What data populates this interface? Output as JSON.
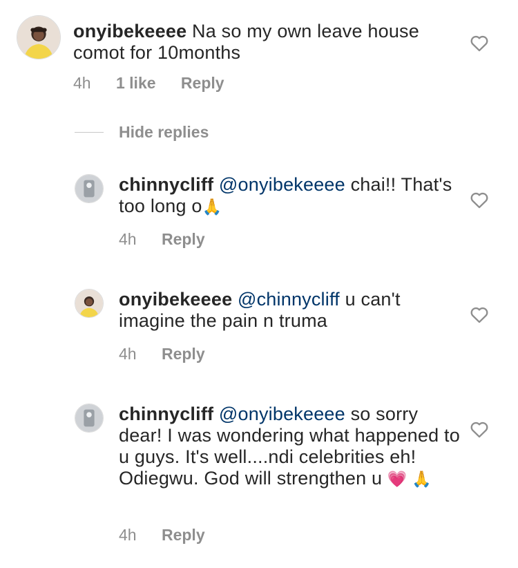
{
  "comments": [
    {
      "username": "onyibekeeee",
      "mention": "",
      "text": "Na so my own leave house comot for 10months",
      "emoji": "",
      "time": "4h",
      "likes": "1 like",
      "reply_label": "Reply",
      "avatar_icon": "woman-yellow-dress-avatar"
    }
  ],
  "hide_replies_label": "Hide replies",
  "replies": [
    {
      "username": "chinnycliff",
      "mention": "@onyibekeeee",
      "text": "chai!! That's too long o",
      "emoji": "🙏",
      "time": "4h",
      "reply_label": "Reply",
      "avatar_icon": "gray-avatar"
    },
    {
      "username": "onyibekeeee",
      "mention": "@chinnycliff",
      "text": "u can't imagine the pain n truma",
      "emoji": "",
      "time": "4h",
      "reply_label": "Reply",
      "avatar_icon": "woman-yellow-dress-avatar"
    },
    {
      "username": "chinnycliff",
      "mention": "@onyibekeeee",
      "text": "so sorry dear! I was wondering what happened to u guys. It's well....ndi celebrities eh! Odiegwu. God will strengthen u",
      "emoji": "💗 🙏",
      "time": "4h",
      "reply_label": "Reply",
      "avatar_icon": "gray-avatar"
    }
  ],
  "colors": {
    "text": "#262626",
    "meta": "#8e8e8e",
    "mention": "#003569",
    "heart_outline": "#8e8e8e"
  }
}
